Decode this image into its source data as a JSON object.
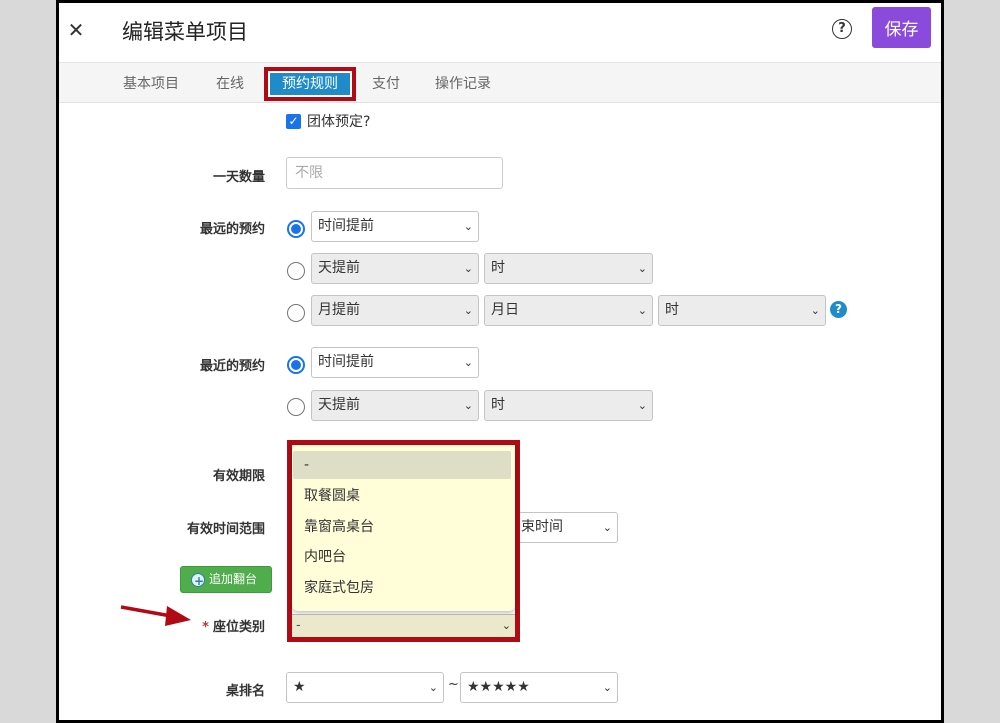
{
  "header": {
    "close_glyph": "✕",
    "title": "编辑菜单项目",
    "help_glyph": "?",
    "save_label": "保存"
  },
  "tabs": [
    {
      "label": "基本项目",
      "active": false
    },
    {
      "label": "在线",
      "active": false
    },
    {
      "label": "预约规则",
      "active": true
    },
    {
      "label": "支付",
      "active": false
    },
    {
      "label": "操作记录",
      "active": false
    }
  ],
  "form": {
    "group_booking": {
      "label": "团体预定?",
      "checked": true
    },
    "daily_quantity": {
      "label": "一天数量",
      "placeholder": "不限",
      "value": ""
    },
    "latest_booking": {
      "label": "最远的预约",
      "options": [
        {
          "checked": true,
          "selects": [
            {
              "value": "时间提前",
              "disabled": false
            }
          ]
        },
        {
          "checked": false,
          "selects": [
            {
              "value": "天提前",
              "disabled": true
            },
            {
              "value": "时",
              "disabled": true
            }
          ]
        },
        {
          "checked": false,
          "selects": [
            {
              "value": "月提前",
              "disabled": true
            },
            {
              "value": "月日",
              "disabled": true
            },
            {
              "value": "时",
              "disabled": true
            }
          ]
        }
      ]
    },
    "nearest_booking": {
      "label": "最近的预约",
      "options": [
        {
          "checked": true,
          "selects": [
            {
              "value": "时间提前",
              "disabled": false
            }
          ]
        },
        {
          "checked": false,
          "selects": [
            {
              "value": "天提前",
              "disabled": true
            },
            {
              "value": "时",
              "disabled": true
            }
          ]
        }
      ]
    },
    "validity_period": {
      "label": "有效期限"
    },
    "valid_time_range": {
      "label": "有效时间范围",
      "end_partial": "束时间"
    },
    "add_turn_button": "追加翻台",
    "seat_type": {
      "required_mark": "*",
      "label": "座位类别",
      "selected": "-",
      "options": [
        "-",
        "取餐圆桌",
        "靠窗高桌台",
        "内吧台",
        "家庭式包房"
      ]
    },
    "table_rank": {
      "label": "桌排名",
      "from": "★",
      "separator": "~",
      "to": "★★★★★"
    }
  },
  "colors": {
    "accent_purple": "#8a4bdc",
    "tab_active_blue": "#1f8cc9",
    "highlight_red": "#b00a14",
    "radio_blue": "#1a73e8",
    "green_button": "#4fae4b",
    "dropdown_bg": "#fffed9"
  }
}
